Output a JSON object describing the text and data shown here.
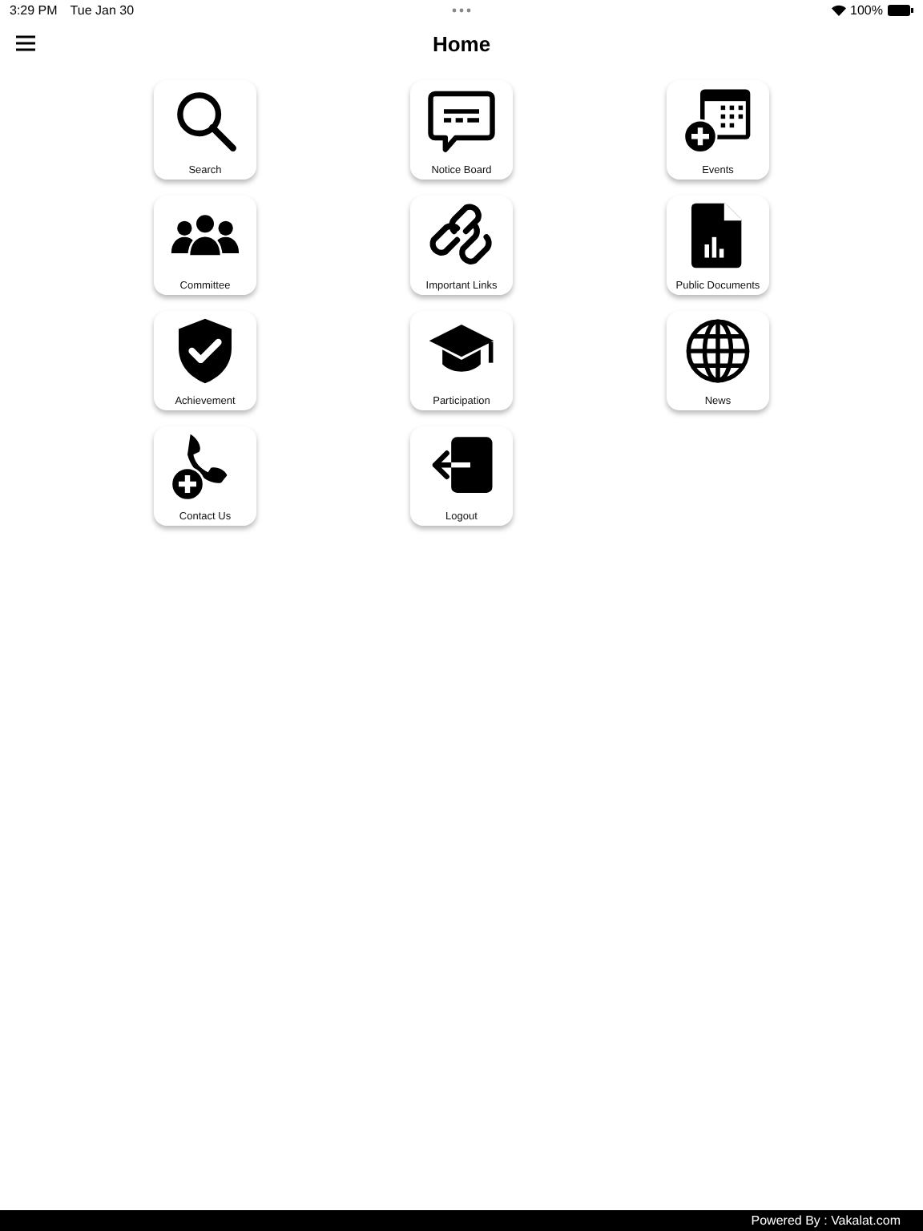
{
  "status_bar": {
    "time": "3:29 PM",
    "date": "Tue Jan 30",
    "battery": "100%"
  },
  "nav": {
    "title": "Home"
  },
  "tiles": [
    {
      "kind": "search",
      "label": "Search"
    },
    {
      "kind": "notice",
      "label": "Notice Board"
    },
    {
      "kind": "events",
      "label": "Events"
    },
    {
      "kind": "committee",
      "label": "Committee"
    },
    {
      "kind": "links",
      "label": "Important Links"
    },
    {
      "kind": "documents",
      "label": "Public Documents"
    },
    {
      "kind": "achievement",
      "label": "Achievement"
    },
    {
      "kind": "participation",
      "label": "Participation"
    },
    {
      "kind": "news",
      "label": "News"
    },
    {
      "kind": "contact",
      "label": "Contact Us"
    },
    {
      "kind": "logout",
      "label": "Logout"
    }
  ],
  "footer": {
    "text": "Powered By : Vakalat.com"
  }
}
